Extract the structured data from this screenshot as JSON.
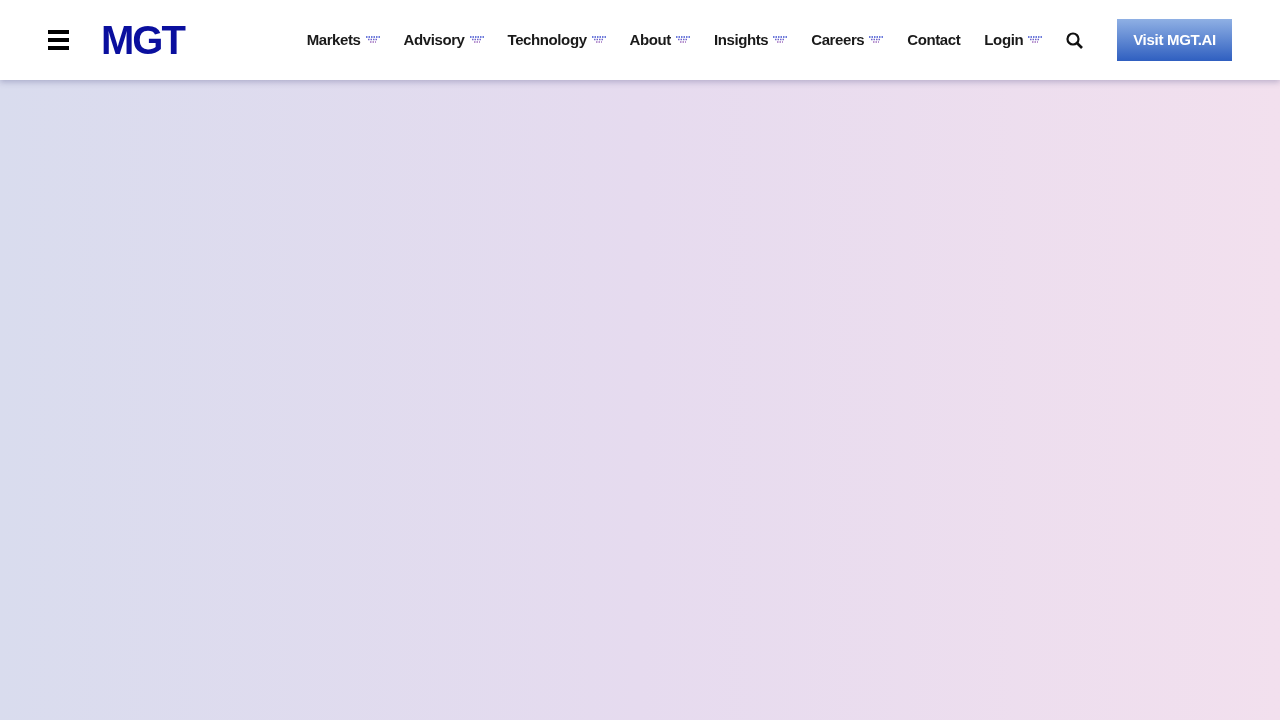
{
  "header": {
    "logo": "MGT",
    "nav": [
      {
        "label": "Markets",
        "dropdown": true
      },
      {
        "label": "Advisory",
        "dropdown": true
      },
      {
        "label": "Technology",
        "dropdown": true
      },
      {
        "label": "About",
        "dropdown": true
      },
      {
        "label": "Insights",
        "dropdown": true
      },
      {
        "label": "Careers",
        "dropdown": true
      },
      {
        "label": "Contact",
        "dropdown": false
      },
      {
        "label": "Login",
        "dropdown": true
      }
    ],
    "cta": "Visit MGT.AI"
  }
}
